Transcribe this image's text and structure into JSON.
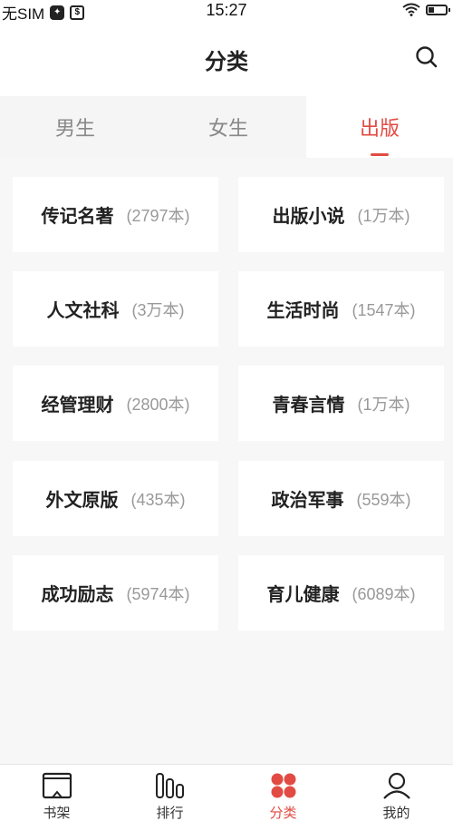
{
  "status_bar": {
    "carrier": "无SIM",
    "time": "15:27"
  },
  "header": {
    "title": "分类",
    "search_icon": "search-icon"
  },
  "tabs": [
    {
      "label": "男生",
      "active": false
    },
    {
      "label": "女生",
      "active": false
    },
    {
      "label": "出版",
      "active": true
    }
  ],
  "categories": [
    {
      "name": "传记名著",
      "count": "(2797本)"
    },
    {
      "name": "出版小说",
      "count": "(1万本)"
    },
    {
      "name": "人文社科",
      "count": "(3万本)"
    },
    {
      "name": "生活时尚",
      "count": "(1547本)"
    },
    {
      "name": "经管理财",
      "count": "(2800本)"
    },
    {
      "name": "青春言情",
      "count": "(1万本)"
    },
    {
      "name": "外文原版",
      "count": "(435本)"
    },
    {
      "name": "政治军事",
      "count": "(559本)"
    },
    {
      "name": "成功励志",
      "count": "(5974本)"
    },
    {
      "name": "育儿健康",
      "count": "(6089本)"
    }
  ],
  "bottom_nav": [
    {
      "label": "书架",
      "icon": "bookshelf-icon",
      "active": false
    },
    {
      "label": "排行",
      "icon": "ranking-icon",
      "active": false
    },
    {
      "label": "分类",
      "icon": "category-icon",
      "active": true
    },
    {
      "label": "我的",
      "icon": "profile-icon",
      "active": false
    }
  ],
  "colors": {
    "accent": "#e24b43",
    "background": "#f7f7f7",
    "card": "#ffffff",
    "muted_text": "#999999"
  }
}
